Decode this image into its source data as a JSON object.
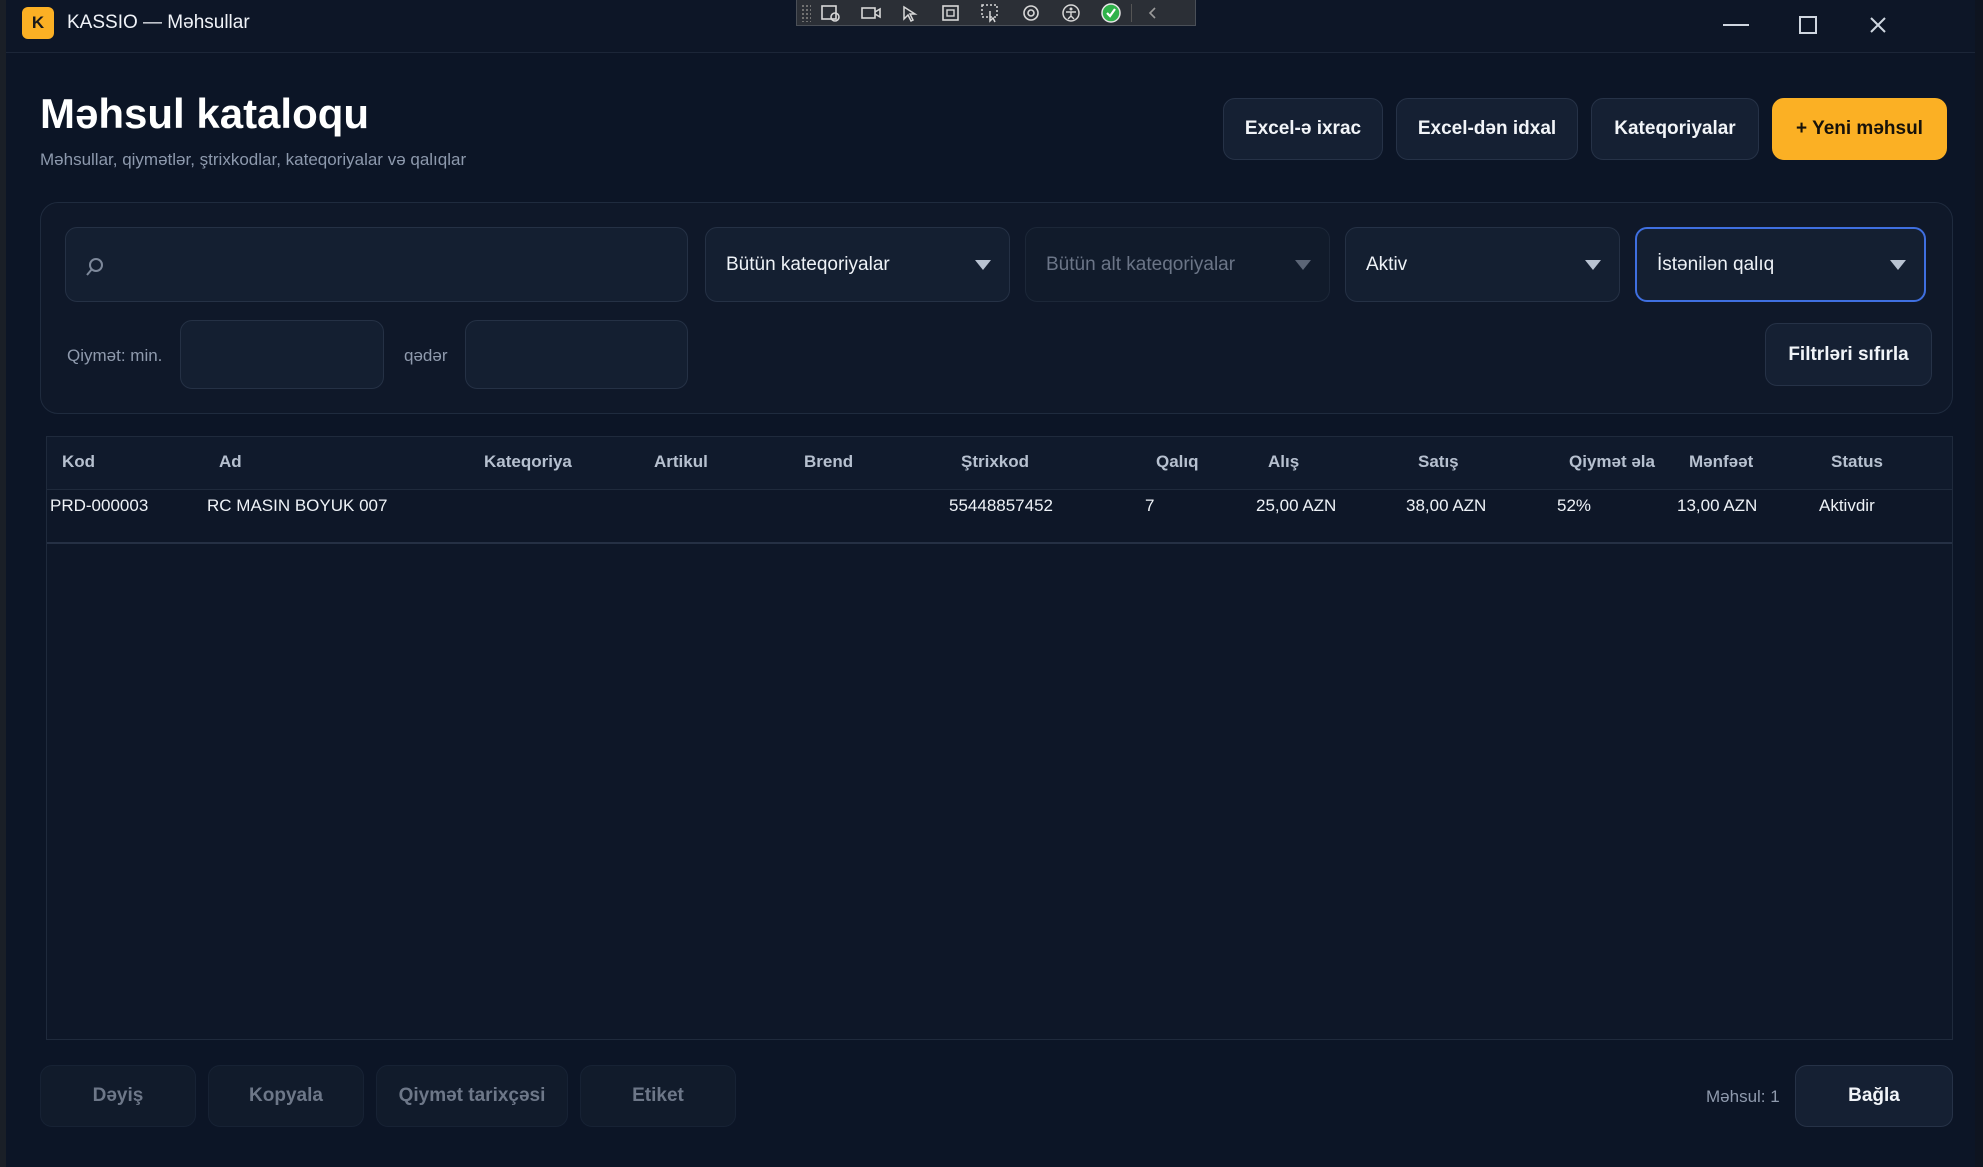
{
  "window": {
    "logo_letter": "K",
    "title": "KASSIO — Məhsullar"
  },
  "header": {
    "title": "Məhsul kataloqu",
    "subtitle": "Məhsullar, qiymətlər, ştrixkodlar, kateqoriyalar və qalıqlar",
    "export_label": "Excel-ə ixrac",
    "import_label": "Excel-dən idxal",
    "categories_label": "Kateqoriyalar",
    "new_label": "+ Yeni məhsul"
  },
  "filters": {
    "search_value": "",
    "category": "Bütün kateqoriyalar",
    "subcategory": "Bütün alt kateqoriyalar",
    "status": "Aktiv",
    "stock": "İstənilən qalıq",
    "price_min_label": "Qiymət: min.",
    "price_max_label": "qədər",
    "price_min_value": "",
    "price_max_value": "",
    "reset_label": "Filtrləri sıfırla"
  },
  "table": {
    "columns": [
      "Kod",
      "Ad",
      "Kateqoriya",
      "Artikul",
      "Brend",
      "Ştrixkod",
      "Qalıq",
      "Alış",
      "Satış",
      "Qiymət əla",
      "Mənfəət",
      "Status"
    ],
    "rows": [
      [
        "PRD-000003",
        "RC MASIN BOYUK 007",
        "",
        "",
        "",
        "55448857452",
        "7",
        "25,00 AZN",
        "38,00 AZN",
        "52%",
        "13,00 AZN",
        "Aktivdir"
      ]
    ]
  },
  "footer": {
    "edit_label": "Dəyiş",
    "copy_label": "Kopyala",
    "price_history_label": "Qiymət tarixçəsi",
    "label_label": "Etiket",
    "count_text": "Məhsul: 1",
    "close_label": "Bağla"
  },
  "colors": {
    "accent": "#fbb024",
    "background": "#0c1526",
    "focus": "#3f6fe0"
  }
}
